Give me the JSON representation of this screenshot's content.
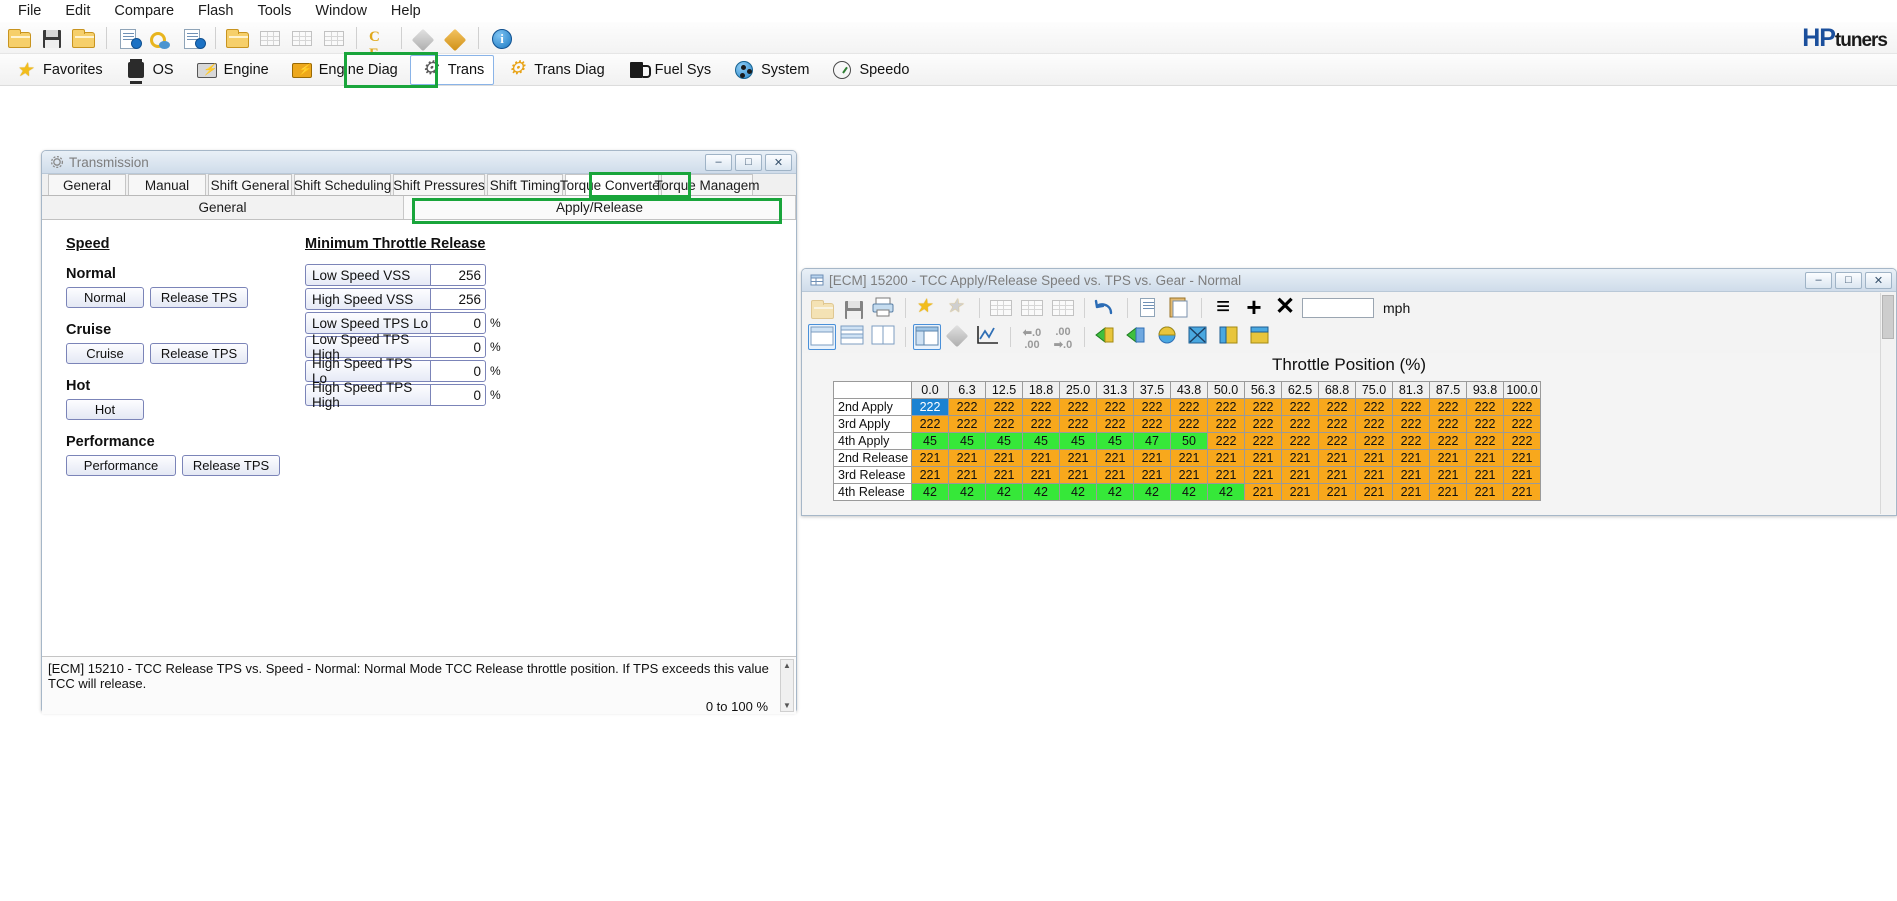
{
  "menubar": {
    "items": [
      "File",
      "Edit",
      "Compare",
      "Flash",
      "Tools",
      "Window",
      "Help"
    ]
  },
  "brand": {
    "hp": "HP",
    "tuners": "tuners"
  },
  "toolbar1": {
    "icons": [
      "open-folder-icon",
      "save-icon",
      "open-recent-icon",
      "file-info-icon",
      "credits-icon",
      "file-history-icon",
      "folder-settings-icon",
      "table-compare-icon",
      "table-icon-2",
      "table-icon-3",
      "units-convert-icon",
      "diamond-gray-icon",
      "diamond-orange-icon",
      "info-icon"
    ]
  },
  "toolbar2": {
    "categories": [
      {
        "label": "Favorites",
        "icon": "star-icon",
        "selected": false
      },
      {
        "label": "OS",
        "icon": "chip-icon",
        "selected": false
      },
      {
        "label": "Engine",
        "icon": "engine-icon",
        "selected": false
      },
      {
        "label": "Engine Diag",
        "icon": "engine-diag-icon",
        "selected": false
      },
      {
        "label": "Trans",
        "icon": "gear-icon",
        "selected": true
      },
      {
        "label": "Trans Diag",
        "icon": "gear-orange-icon",
        "selected": false
      },
      {
        "label": "Fuel Sys",
        "icon": "fuel-pump-icon",
        "selected": false
      },
      {
        "label": "System",
        "icon": "system-icon",
        "selected": false
      },
      {
        "label": "Speedo",
        "icon": "speedometer-icon",
        "selected": false
      }
    ]
  },
  "transmission_window": {
    "title": "Transmission",
    "window_icon": "gear-icon",
    "buttons": {
      "minimize": "–",
      "maximize": "□",
      "close": "✕"
    },
    "tabs": [
      {
        "label": "General",
        "active": false
      },
      {
        "label": "Manual",
        "active": false
      },
      {
        "label": "Shift General",
        "active": false
      },
      {
        "label": "Shift Scheduling",
        "active": false
      },
      {
        "label": "Shift Pressures",
        "active": false
      },
      {
        "label": "Shift Timing",
        "active": false
      },
      {
        "label": "Torque Converter",
        "active": true
      },
      {
        "label": "Torque Managem",
        "active": false
      }
    ],
    "subtabs": [
      {
        "label": "General",
        "active": false
      },
      {
        "label": "Apply/Release",
        "active": true
      }
    ],
    "speed_section": {
      "heading": "Speed",
      "groups": [
        {
          "title": "Normal",
          "buttons": [
            "Normal",
            "Release TPS"
          ]
        },
        {
          "title": "Cruise",
          "buttons": [
            "Cruise",
            "Release TPS"
          ]
        },
        {
          "title": "Hot",
          "buttons": [
            "Hot"
          ]
        },
        {
          "title": "Performance",
          "buttons": [
            "Performance",
            "Release TPS"
          ]
        }
      ]
    },
    "min_throttle_section": {
      "heading": "Minimum Throttle Release",
      "fields": [
        {
          "label": "Low Speed VSS",
          "value": "256",
          "unit": ""
        },
        {
          "label": "High Speed VSS",
          "value": "256",
          "unit": ""
        },
        {
          "label": "Low Speed TPS Lo",
          "value": "0",
          "unit": "%"
        },
        {
          "label": "Low Speed TPS High",
          "value": "0",
          "unit": "%"
        },
        {
          "label": "High Speed TPS Lo",
          "value": "0",
          "unit": "%"
        },
        {
          "label": "High Speed TPS High",
          "value": "0",
          "unit": "%"
        }
      ]
    },
    "statusbar": {
      "description": "[ECM] 15210 - TCC Release TPS vs. Speed - Normal: Normal Mode TCC Release throttle position. If TPS exceeds this value TCC will release.",
      "range": "0 to 100 %",
      "scroll_up": "▲",
      "scroll_down": "▼"
    }
  },
  "table_window": {
    "title": "[ECM] 15200 - TCC Apply/Release Speed vs. TPS vs. Gear - Normal",
    "window_icon": "table-icon",
    "buttons": {
      "minimize": "–",
      "maximize": "□",
      "close": "✕"
    },
    "toolbar_row1": [
      "open-icon",
      "save-icon",
      "print-icon",
      "add-favorite-icon",
      "remove-favorite-icon",
      "table-grid-icon-1",
      "table-grid-icon-2",
      "table-grid-icon-3",
      "undo-icon",
      "copy-icon",
      "paste-icon",
      "equals-icon",
      "plus-icon",
      "multiply-icon"
    ],
    "toolbar_row2": [
      "view-single-icon",
      "view-split-horizontal-icon",
      "view-split-vertical-icon",
      "view-table-icon",
      "diamond-icon",
      "graph-icon",
      "decimal-decrease-icon",
      "decimal-increase-icon",
      "decimal-left-icon",
      "decimal-right-icon",
      "color-green-icon",
      "color-gradient-icon",
      "color-yellow-icon",
      "color-x-icon",
      "color-border-icon",
      "color-fill-icon"
    ],
    "value_input": "",
    "units": "mph",
    "table_caption": "Throttle Position (%)",
    "chart_data": {
      "type": "table",
      "title": "Throttle Position (%)",
      "xlabel": "Throttle Position (%)",
      "ylabel": "",
      "categories": [
        "0.0",
        "6.3",
        "12.5",
        "18.8",
        "25.0",
        "31.3",
        "37.5",
        "43.8",
        "50.0",
        "56.3",
        "62.5",
        "68.8",
        "75.0",
        "81.3",
        "87.5",
        "93.8",
        "100.0"
      ],
      "row_labels": [
        "2nd Apply",
        "3rd Apply",
        "4th Apply",
        "2nd Release",
        "3rd Release",
        "4th Release"
      ],
      "series": [
        {
          "name": "2nd Apply",
          "values": [
            222,
            222,
            222,
            222,
            222,
            222,
            222,
            222,
            222,
            222,
            222,
            222,
            222,
            222,
            222,
            222,
            222
          ]
        },
        {
          "name": "3rd Apply",
          "values": [
            222,
            222,
            222,
            222,
            222,
            222,
            222,
            222,
            222,
            222,
            222,
            222,
            222,
            222,
            222,
            222,
            222
          ]
        },
        {
          "name": "4th Apply",
          "values": [
            45,
            45,
            45,
            45,
            45,
            45,
            47,
            50,
            222,
            222,
            222,
            222,
            222,
            222,
            222,
            222,
            222
          ]
        },
        {
          "name": "2nd Release",
          "values": [
            221,
            221,
            221,
            221,
            221,
            221,
            221,
            221,
            221,
            221,
            221,
            221,
            221,
            221,
            221,
            221,
            221
          ]
        },
        {
          "name": "3rd Release",
          "values": [
            221,
            221,
            221,
            221,
            221,
            221,
            221,
            221,
            221,
            221,
            221,
            221,
            221,
            221,
            221,
            221,
            221
          ]
        },
        {
          "name": "4th Release",
          "values": [
            42,
            42,
            42,
            42,
            42,
            42,
            42,
            42,
            42,
            221,
            221,
            221,
            221,
            221,
            221,
            221,
            221
          ]
        }
      ],
      "cell_colors": [
        [
          "blue",
          "orange",
          "orange",
          "orange",
          "orange",
          "orange",
          "orange",
          "orange",
          "orange",
          "orange",
          "orange",
          "orange",
          "orange",
          "orange",
          "orange",
          "orange",
          "orange"
        ],
        [
          "orange",
          "orange",
          "orange",
          "orange",
          "orange",
          "orange",
          "orange",
          "orange",
          "orange",
          "orange",
          "orange",
          "orange",
          "orange",
          "orange",
          "orange",
          "orange",
          "orange"
        ],
        [
          "green",
          "green",
          "green",
          "green",
          "green",
          "green",
          "green",
          "green",
          "orange",
          "orange",
          "orange",
          "orange",
          "orange",
          "orange",
          "orange",
          "orange",
          "orange"
        ],
        [
          "orange",
          "orange",
          "orange",
          "orange",
          "orange",
          "orange",
          "orange",
          "orange",
          "orange",
          "orange",
          "orange",
          "orange",
          "orange",
          "orange",
          "orange",
          "orange",
          "orange"
        ],
        [
          "orange",
          "orange",
          "orange",
          "orange",
          "orange",
          "orange",
          "orange",
          "orange",
          "orange",
          "orange",
          "orange",
          "orange",
          "orange",
          "orange",
          "orange",
          "orange",
          "orange"
        ],
        [
          "green",
          "green",
          "green",
          "green",
          "green",
          "green",
          "green",
          "green",
          "green",
          "orange",
          "orange",
          "orange",
          "orange",
          "orange",
          "orange",
          "orange",
          "orange"
        ]
      ],
      "colors": {
        "orange": "#f8a81c",
        "green": "#36e839",
        "blue": "#1b82d2",
        "selected_cell": "0,0"
      }
    }
  },
  "annotations": {
    "accent": "#19a53b",
    "boxes": [
      "trans-category-button",
      "torque-converter-tab",
      "apply-release-subtab"
    ]
  }
}
